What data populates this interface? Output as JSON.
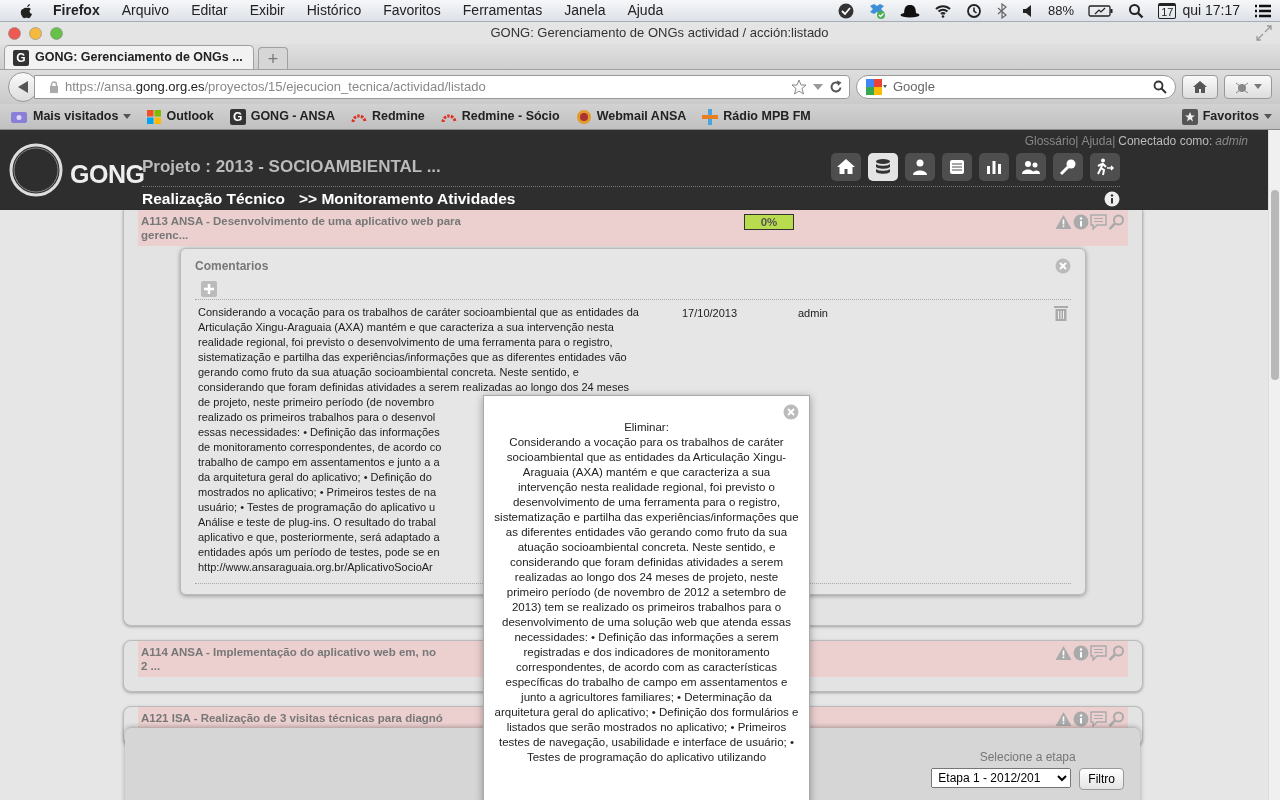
{
  "menubar": {
    "app": "Firefox",
    "items": [
      "Arquivo",
      "Editar",
      "Exibir",
      "Histórico",
      "Favoritos",
      "Ferramentas",
      "Janela",
      "Ajuda"
    ],
    "battery": "88%",
    "calendar_day": "17",
    "clock": "qui 17:17"
  },
  "window": {
    "title": "GONG: Gerenciamento de ONGs actividad / acción:listado"
  },
  "tabs": [
    {
      "label": "GONG: Gerenciamento de ONGs ...",
      "favicon": "G",
      "selected": true
    }
  ],
  "new_tab": "+",
  "address_bar": {
    "prefix": "https://ansa.",
    "host": "gong.org.es",
    "path": "/proyectos/15/ejecucion_tecnica/actividad/listado"
  },
  "search": {
    "placeholder": "Google"
  },
  "bookmarks": [
    {
      "label": "Mais visitados",
      "kind": "folder"
    },
    {
      "label": "Outlook",
      "kind": "squares"
    },
    {
      "label": "GONG - ANSA",
      "kind": "letter",
      "favicon": "G"
    },
    {
      "label": "Redmine",
      "kind": "arc"
    },
    {
      "label": "Redmine - Sócio",
      "kind": "arc"
    },
    {
      "label": "Webmail ANSA",
      "kind": "globe"
    },
    {
      "label": "Rádio MPB FM",
      "kind": "cross"
    }
  ],
  "bookmarks_menu": "Favoritos",
  "app_header": {
    "logo": "GONG",
    "project": "Projeto : 2013 - SOCIOAMBIENTAL ...",
    "links": [
      "Glossário|",
      "Ajuda|"
    ],
    "user_label": "Conectado como:",
    "user": "admin",
    "nav": [
      {
        "kind": "home",
        "selected": false
      },
      {
        "kind": "database",
        "selected": true
      },
      {
        "kind": "user",
        "selected": false
      },
      {
        "kind": "book",
        "selected": false
      },
      {
        "kind": "chart",
        "selected": false
      },
      {
        "kind": "users",
        "selected": false
      },
      {
        "kind": "key",
        "selected": false
      },
      {
        "kind": "exit",
        "selected": false
      }
    ],
    "breadcrumb": [
      "Realização Técnico",
      ">> Monitoramento Atividades"
    ]
  },
  "activities": [
    {
      "title_lines": [
        "A113 ANSA - Desenvolvimento de uma aplicativo web para",
        "gerenc..."
      ],
      "progress": "0%",
      "level": 1,
      "comments": {
        "title": "Comentarios",
        "rows": [
          {
            "text_lines": [
              "Considerando a vocação para os trabalhos de caráter socioambiental que as entidades da",
              "Articulação Xingu-Araguaia (AXA) mantém e que caracteriza a sua intervenção nesta",
              "realidade regional, foi previsto o desenvolvimento de uma ferramenta para o registro,",
              "sistematização e partilha das experiências/informações que as diferentes entidades vão",
              "gerando como fruto da sua atuação socioambiental concreta. Neste sentido, e",
              "considerando que foram definidas atividades a serem realizadas ao longo dos 24 meses",
              "de projeto, neste primeiro período (de novembro",
              "realizado os primeiros trabalhos para o desenvol",
              "essas necessidades: • Definição das informações",
              "de monitoramento correspondentes, de acordo co",
              "trabalho de campo em assentamentos e junto a a",
              "da arquitetura geral do aplicativo; • Definição do",
              "mostrados no aplicativo; • Primeiros testes de na",
              "usuário; • Testes de programação do aplicativo u",
              "Análise e teste de plug-ins. O resultado do trabal",
              "aplicativo e que, posteriormente, será adaptado a",
              "entidades após um período de testes, pode se en",
              "http://www.ansaraguaia.org.br/AplicativoSocioAr"
            ],
            "date": "17/10/2013",
            "author": "admin"
          }
        ]
      }
    },
    {
      "title_lines": [
        "A114 ANSA - Implementação do aplicativo web em, no",
        "2 ..."
      ]
    },
    {
      "title_lines": [
        "A121 ISA - Realização de 3 visitas técnicas para diagnó"
      ]
    }
  ],
  "filter_panel": {
    "label": "Selecione a etapa",
    "stage": "Etapa 1 - 2012/201",
    "button": "Filtro"
  },
  "delete_popup": {
    "heading": "Eliminar:",
    "text": "Considerando a vocação para os trabalhos de caráter socioambiental que as entidades da Articulação Xingu-Araguaia (AXA) mantém e que caracteriza a sua intervenção nesta realidade regional, foi previsto o desenvolvimento de uma ferramenta para o registro, sistematização e partilha das experiências/informações que as diferentes entidades vão gerando como fruto da sua atuação socioambiental concreta. Neste sentido, e considerando que foram definidas atividades a serem realizadas ao longo dos 24 meses de projeto, neste primeiro período (de novembro de 2012 a setembro de 2013) tem se realizado os primeiros trabalhos para o desenvolvimento de uma solução web que atenda essas necessidades: • Definição das informações a serem registradas e dos indicadores de monitoramento correspondentes, de acordo com as características específicas do trabalho de campo em assentamentos e junto a agricultores familiares; • Determinação da arquitetura geral do aplicativo; • Definição dos formulários e listados que serão mostrados no aplicativo; • Primeiros testes de navegação, usabilidade e interface de usuário; • Testes de programação do aplicativo utilizando"
  }
}
